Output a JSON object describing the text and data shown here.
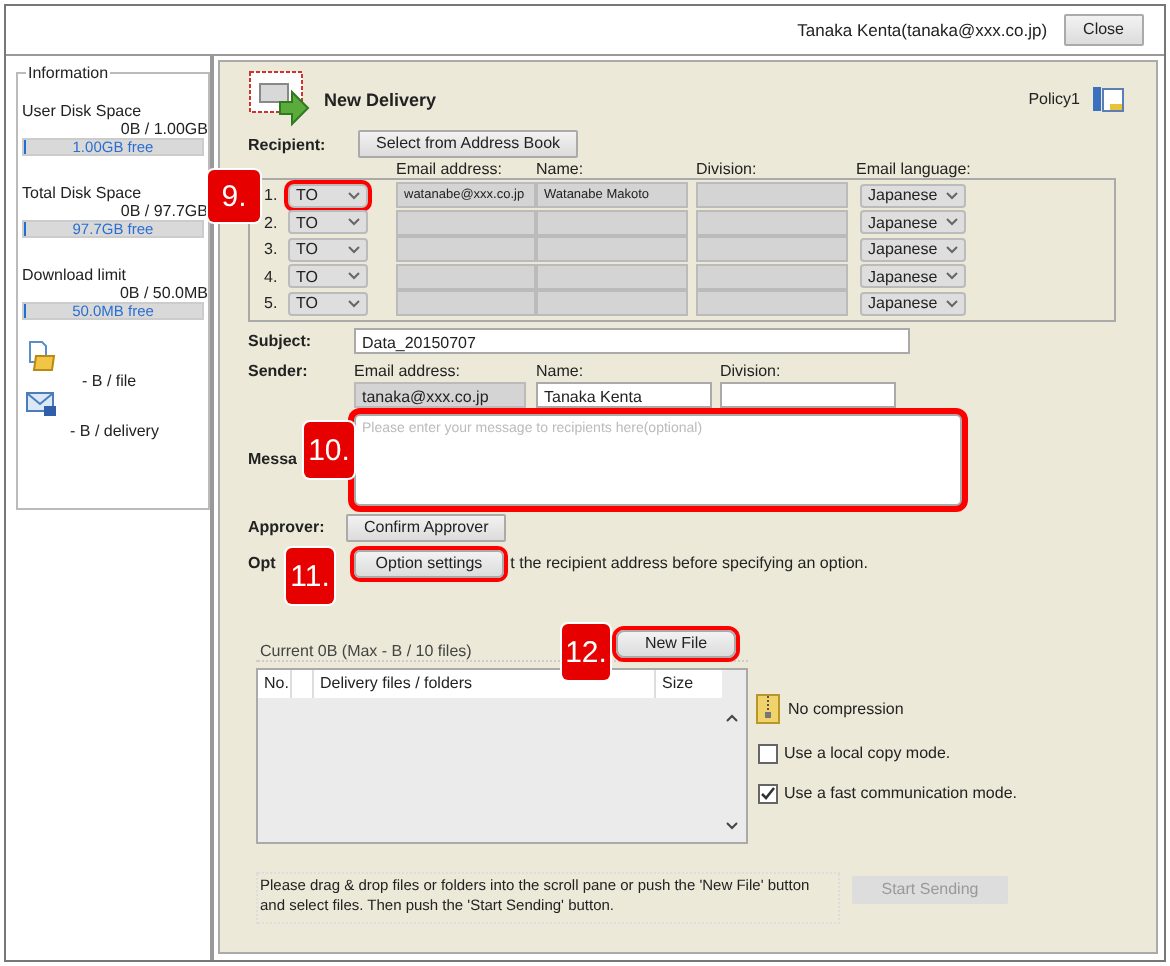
{
  "header": {
    "user": "Tanaka Kenta(tanaka@xxx.co.jp)",
    "close_button": "Close"
  },
  "information": {
    "title": "Information",
    "meters": [
      {
        "label": "User Disk Space",
        "reading": "0B / 1.00GB",
        "free": "1.00GB free",
        "level": 0.01
      },
      {
        "label": "Total Disk Space",
        "reading": "0B / 97.7GB",
        "free": "97.7GB free",
        "level": 0.01
      },
      {
        "label": "Download limit",
        "reading": "0B / 50.0MB",
        "free": "50.0MB free",
        "level": 0.01
      }
    ],
    "limits": [
      {
        "kind": "file",
        "text": "- B / file"
      },
      {
        "kind": "delivery",
        "text": "- B / delivery"
      }
    ]
  },
  "title": "New Delivery",
  "policy": "Policy1",
  "recipient": {
    "label": "Recipient:",
    "address_book_button": "Select from Address Book",
    "columns": [
      "Email address:",
      "Name:",
      "Division:",
      "Email language:"
    ],
    "rows": [
      {
        "number": "1.",
        "type": "TO",
        "highlighted": true,
        "email": "watanabe@xxx.co.jp",
        "name": "Watanabe Makoto",
        "language": "Japanese"
      },
      {
        "number": "2.",
        "type": "TO",
        "highlighted": false,
        "language": "Japanese"
      },
      {
        "number": "3.",
        "type": "TO",
        "highlighted": false,
        "language": "Japanese"
      },
      {
        "number": "4.",
        "type": "TO",
        "highlighted": false,
        "language": "Japanese"
      },
      {
        "number": "5.",
        "type": "TO",
        "highlighted": false,
        "language": "Japanese"
      }
    ]
  },
  "subject": {
    "label": "Subject:",
    "value": "Data_20150707"
  },
  "sender": {
    "label": "Sender:",
    "columns": [
      "Email address:",
      "Name:",
      "Division:"
    ],
    "email": "tanaka@xxx.co.jp",
    "name": "Tanaka Kenta"
  },
  "message": {
    "label": "Messa",
    "placeholder": "Please enter your message to recipients here(optional)",
    "highlighted": true
  },
  "approver": {
    "label": "Approver:",
    "button": "Confirm Approver"
  },
  "options": {
    "label": "Opt",
    "button": "Option settings",
    "highlighted": true,
    "note": "t the recipient address before specifying an option."
  },
  "files": {
    "summary": "Current 0B (Max - B / 10 files)",
    "new_file_button": "New File",
    "new_file_highlighted": true,
    "columns": [
      "No.",
      "Delivery files / folders",
      "Size"
    ]
  },
  "compression": "No compression",
  "settings": [
    {
      "label": "Use a local copy mode.",
      "checked": false
    },
    {
      "label": "Use a fast communication mode.",
      "checked": true
    }
  ],
  "instructions": "Please drag & drop files or folders into the scroll pane or push the 'New File' button and select files. Then push the 'Start Sending' button.",
  "send_button": {
    "label": "Start Sending",
    "disabled": true
  },
  "callouts": [
    "9.",
    "10.",
    "11.",
    "12."
  ]
}
